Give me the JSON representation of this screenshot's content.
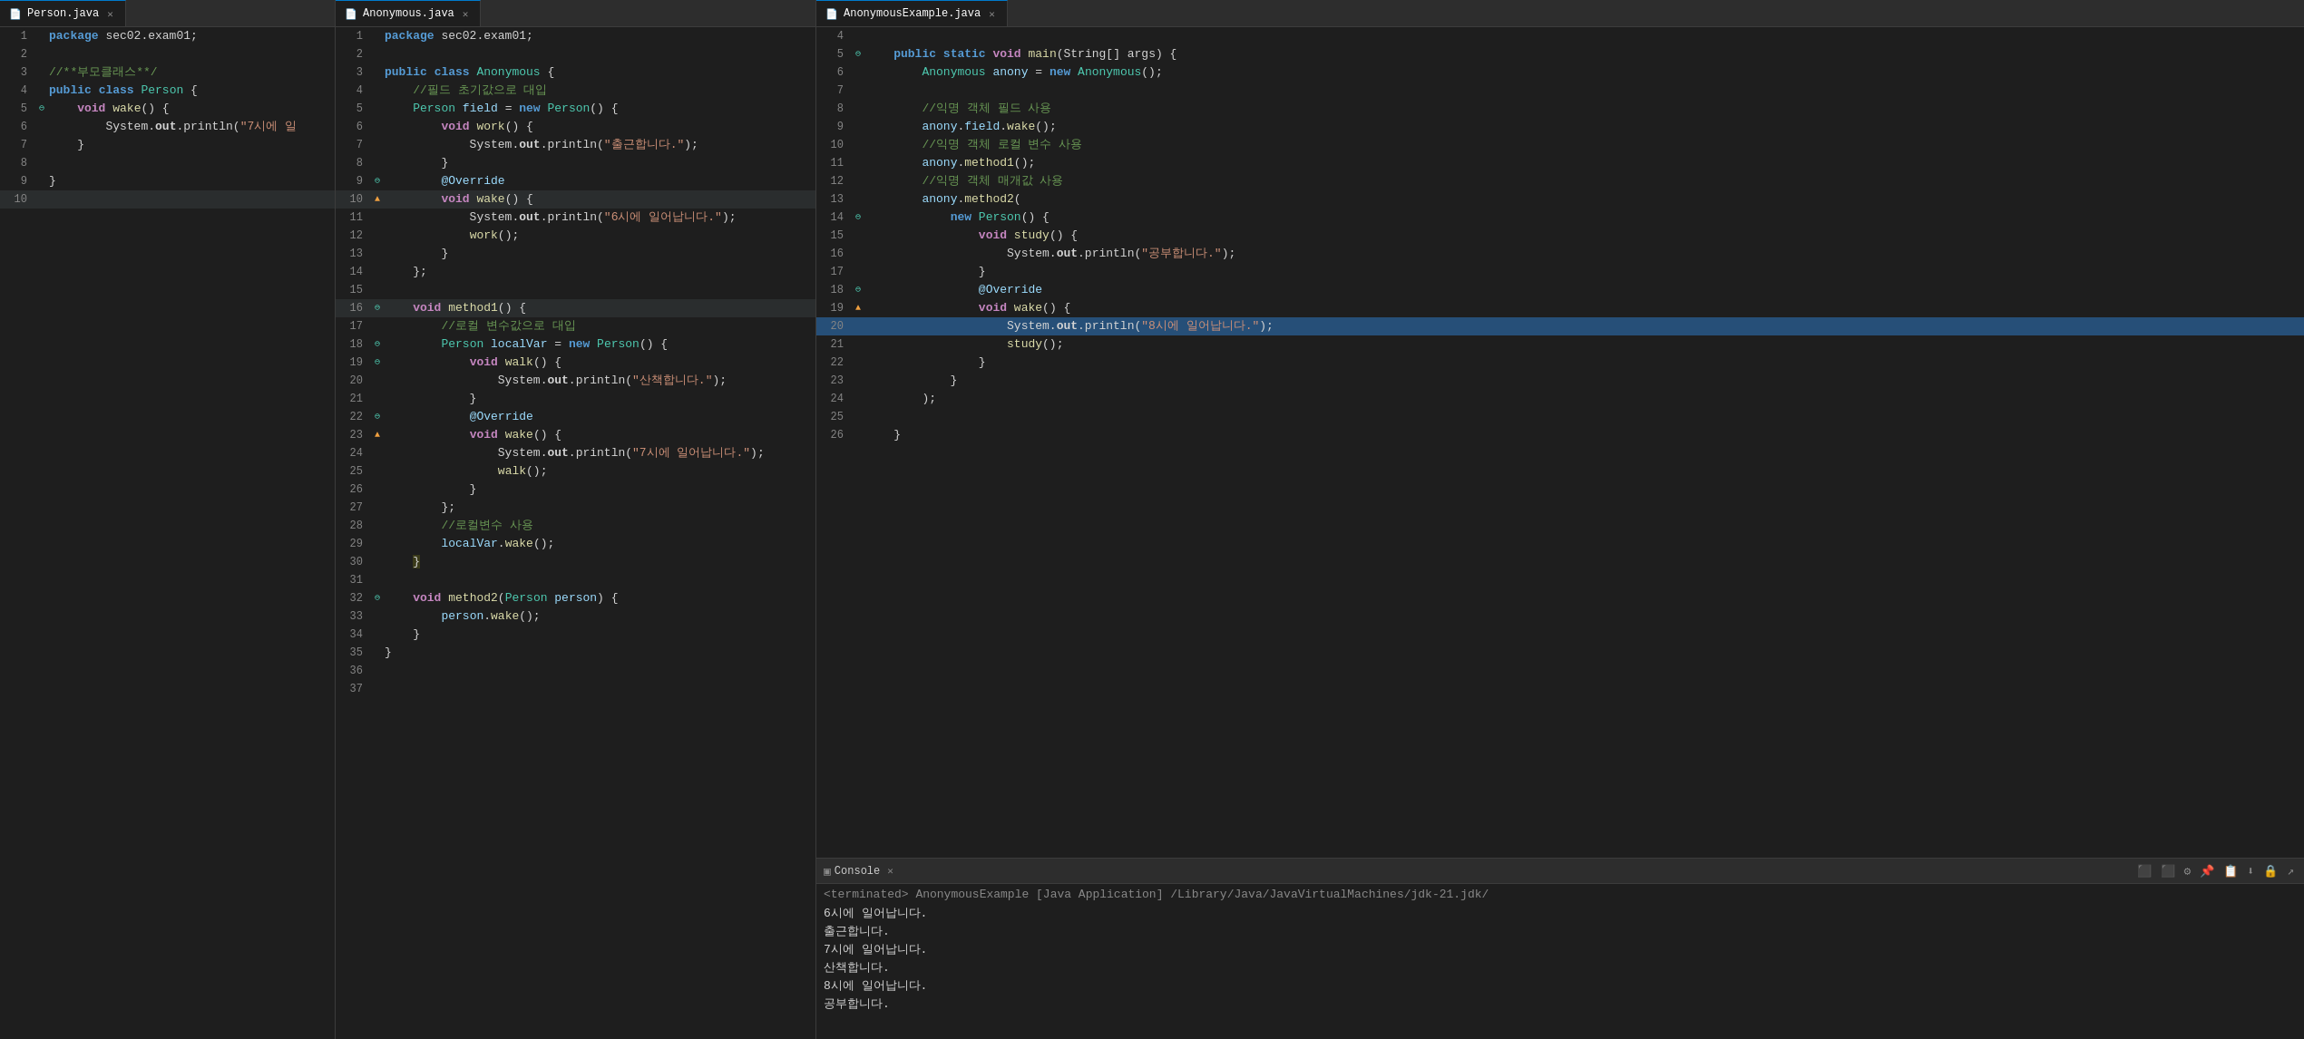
{
  "tabs": {
    "person": "Person.java",
    "anonymous": "Anonymous.java",
    "anonymousExample": "AnonymousExample.java"
  },
  "console": {
    "label": "Console",
    "terminated": "<terminated> AnonymousExample [Java Application] /Library/Java/JavaVirtualMachines/jdk-21.jdk/",
    "output": [
      "6시에  일어납니다.",
      "출근합니다.",
      "7시에  일어납니다.",
      "산책합니다.",
      "8시에  일어납니다.",
      "공부합니다."
    ]
  },
  "person_code": [
    {
      "n": 1,
      "g": "",
      "t": "kw",
      "c": "package sec02.exam01;"
    },
    {
      "n": 2,
      "g": "",
      "t": "plain",
      "c": ""
    },
    {
      "n": 3,
      "g": "",
      "t": "comment",
      "c": "//**부모클래스**/"
    },
    {
      "n": 4,
      "g": "",
      "t": "mixed",
      "c": "public class Person {"
    },
    {
      "n": 5,
      "g": "⊖",
      "t": "mixed",
      "c": "    void wake() {"
    },
    {
      "n": 6,
      "g": "",
      "t": "str",
      "c": "        System.out.println(\"7시에 일\")"
    },
    {
      "n": 7,
      "g": "",
      "t": "plain",
      "c": "    }"
    },
    {
      "n": 8,
      "g": "",
      "t": "plain",
      "c": ""
    },
    {
      "n": 9,
      "g": "",
      "t": "plain",
      "c": "}"
    },
    {
      "n": 10,
      "g": "",
      "t": "plain",
      "c": ""
    }
  ],
  "anonymous_code": [
    {
      "n": 1,
      "g": "",
      "hl": false,
      "c": "package sec02.exam01;"
    },
    {
      "n": 2,
      "g": "",
      "hl": false,
      "c": ""
    },
    {
      "n": 3,
      "g": "",
      "hl": false,
      "c": "public class Anonymous {"
    },
    {
      "n": 4,
      "g": "",
      "hl": false,
      "c": "    //필드 초기값으로 대입"
    },
    {
      "n": 5,
      "g": "",
      "hl": false,
      "c": "    Person field = new Person() {"
    },
    {
      "n": 6,
      "g": "",
      "hl": false,
      "c": "        void work() {"
    },
    {
      "n": 7,
      "g": "",
      "hl": false,
      "c": "            System.out.println(\"출근합니다.\");"
    },
    {
      "n": 8,
      "g": "",
      "hl": false,
      "c": "        }"
    },
    {
      "n": 9,
      "g": "⊖",
      "hl": false,
      "c": "        @Override"
    },
    {
      "n": 10,
      "g": "▲",
      "hl": true,
      "c": "        void wake() {"
    },
    {
      "n": 11,
      "g": "",
      "hl": false,
      "c": "            System.out.println(\"6시에 일어납니다.\");"
    },
    {
      "n": 12,
      "g": "",
      "hl": false,
      "c": "            work();"
    },
    {
      "n": 13,
      "g": "",
      "hl": false,
      "c": "        }"
    },
    {
      "n": 14,
      "g": "",
      "hl": false,
      "c": "    };"
    },
    {
      "n": 15,
      "g": "",
      "hl": false,
      "c": ""
    },
    {
      "n": 16,
      "g": "⊖",
      "hl": true,
      "c": "    void method1() {"
    },
    {
      "n": 17,
      "g": "",
      "hl": false,
      "c": "        //로컬 변수값으로 대입"
    },
    {
      "n": 18,
      "g": "⊖",
      "hl": false,
      "c": "        Person localVar = new Person() {"
    },
    {
      "n": 19,
      "g": "⊖",
      "hl": false,
      "c": "            void walk() {"
    },
    {
      "n": 20,
      "g": "",
      "hl": false,
      "c": "                System.out.println(\"산책합니다.\");"
    },
    {
      "n": 21,
      "g": "",
      "hl": false,
      "c": "            }"
    },
    {
      "n": 22,
      "g": "⊖",
      "hl": false,
      "c": "            @Override"
    },
    {
      "n": 23,
      "g": "▲",
      "hl": false,
      "c": "            void wake() {"
    },
    {
      "n": 24,
      "g": "",
      "hl": false,
      "c": "                System.out.println(\"7시에 일어납니다.\");"
    },
    {
      "n": 25,
      "g": "",
      "hl": false,
      "c": "                walk();"
    },
    {
      "n": 26,
      "g": "",
      "hl": false,
      "c": "            }"
    },
    {
      "n": 27,
      "g": "",
      "hl": false,
      "c": "        };"
    },
    {
      "n": 28,
      "g": "",
      "hl": false,
      "c": "        //로컬변수 사용"
    },
    {
      "n": 29,
      "g": "",
      "hl": false,
      "c": "        localVar.wake();"
    },
    {
      "n": 30,
      "g": "",
      "hl": false,
      "c": "    }"
    },
    {
      "n": 31,
      "g": "",
      "hl": false,
      "c": ""
    },
    {
      "n": 32,
      "g": "⊖",
      "hl": false,
      "c": "    void method2(Person person) {"
    },
    {
      "n": 33,
      "g": "",
      "hl": false,
      "c": "        person.wake();"
    },
    {
      "n": 34,
      "g": "",
      "hl": false,
      "c": "    }"
    },
    {
      "n": 35,
      "g": "",
      "hl": false,
      "c": "}"
    },
    {
      "n": 36,
      "g": "",
      "hl": false,
      "c": ""
    },
    {
      "n": 37,
      "g": "",
      "hl": false,
      "c": ""
    }
  ],
  "example_code": [
    {
      "n": 4,
      "g": "",
      "hl": false
    },
    {
      "n": 5,
      "g": "⊖",
      "hl": false
    },
    {
      "n": 6,
      "g": "",
      "hl": false
    },
    {
      "n": 7,
      "g": "",
      "hl": false
    },
    {
      "n": 8,
      "g": "",
      "hl": false
    },
    {
      "n": 9,
      "g": "",
      "hl": false
    },
    {
      "n": 10,
      "g": "",
      "hl": false
    },
    {
      "n": 11,
      "g": "",
      "hl": false
    },
    {
      "n": 12,
      "g": "",
      "hl": false
    },
    {
      "n": 13,
      "g": "",
      "hl": false
    },
    {
      "n": 14,
      "g": "⊖",
      "hl": false
    },
    {
      "n": 15,
      "g": "",
      "hl": false
    },
    {
      "n": 16,
      "g": "",
      "hl": false
    },
    {
      "n": 17,
      "g": "",
      "hl": false
    },
    {
      "n": 18,
      "g": "⊖",
      "hl": false
    },
    {
      "n": 19,
      "g": "▲",
      "hl": false
    },
    {
      "n": 20,
      "g": "",
      "hl": true
    },
    {
      "n": 21,
      "g": "",
      "hl": false
    },
    {
      "n": 22,
      "g": "",
      "hl": false
    },
    {
      "n": 23,
      "g": "",
      "hl": false
    },
    {
      "n": 24,
      "g": "",
      "hl": false
    },
    {
      "n": 25,
      "g": "",
      "hl": false
    },
    {
      "n": 26,
      "g": "",
      "hl": false
    }
  ]
}
